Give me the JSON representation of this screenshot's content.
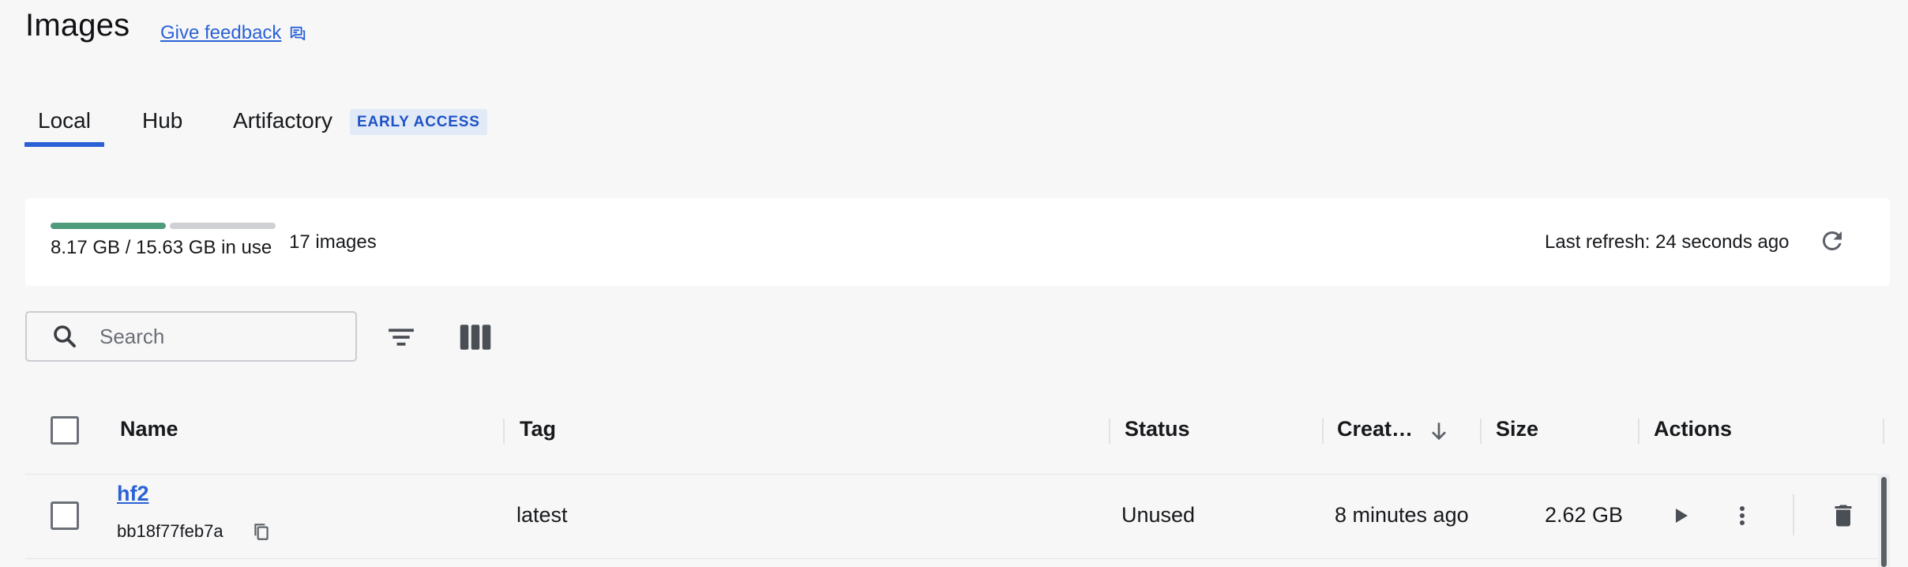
{
  "header": {
    "title": "Images",
    "feedback_label": "Give feedback"
  },
  "tabs": [
    {
      "label": "Local",
      "active": true
    },
    {
      "label": "Hub",
      "active": false
    },
    {
      "label": "Artifactory",
      "active": false,
      "badge": "EARLY ACCESS"
    }
  ],
  "usage": {
    "disk_text": "8.17 GB / 15.63 GB in use",
    "used_fraction": 0.523,
    "image_count_text": "17 images",
    "last_refresh_text": "Last refresh: 24 seconds ago",
    "used_color": "#4f9c7d",
    "free_color": "#cfd1d5"
  },
  "toolbar": {
    "search_placeholder": "Search",
    "search_value": ""
  },
  "table": {
    "columns": [
      "Name",
      "Tag",
      "Status",
      "Creat…",
      "Size",
      "Actions"
    ],
    "sort": {
      "column": "Created",
      "direction": "descending"
    },
    "rows": [
      {
        "name": "hf2",
        "id": "bb18f77feb7a",
        "tag": "latest",
        "status": "Unused",
        "created": "8 minutes ago",
        "size": "2.62 GB"
      }
    ]
  },
  "colors": {
    "accent": "#2a62d6",
    "background": "#f7f7f7",
    "card": "#ffffff"
  }
}
